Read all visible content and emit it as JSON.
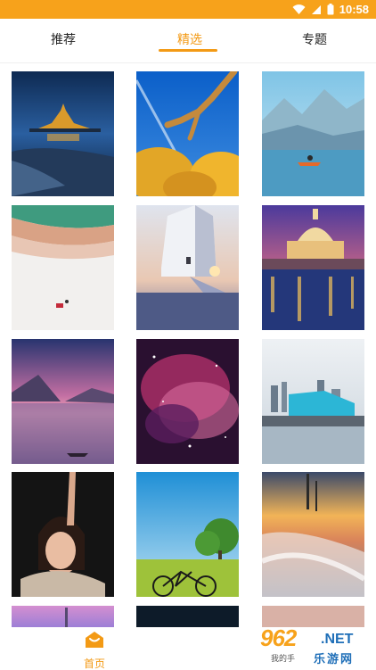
{
  "status_bar": {
    "time": "10:58",
    "color": "#f7a21b"
  },
  "tabs": [
    {
      "label": "推荐",
      "active": false
    },
    {
      "label": "精选",
      "active": true
    },
    {
      "label": "专题",
      "active": false
    }
  ],
  "accent_color": "#f39a15",
  "thumbnails": [
    {
      "subject": "night-castle-island"
    },
    {
      "subject": "bare-branch-blue-sky-autumn-trees"
    },
    {
      "subject": "kayaker-on-mountain-lake"
    },
    {
      "subject": "aerial-beach-waves"
    },
    {
      "subject": "white-tower-sunset"
    },
    {
      "subject": "domed-city-night-reflection"
    },
    {
      "subject": "pink-sky-mountain-lake-boat"
    },
    {
      "subject": "orion-nebula"
    },
    {
      "subject": "city-skyline-waterfront"
    },
    {
      "subject": "portrait-woman-raised-arm"
    },
    {
      "subject": "bicycle-on-green-meadow"
    },
    {
      "subject": "sunset-long-exposure-waves"
    },
    {
      "subject": "partial-pink-spire"
    },
    {
      "subject": "partial-dark-night"
    },
    {
      "subject": "partial-pale-sky"
    }
  ],
  "bottom_nav": {
    "home_label": "首页"
  },
  "watermark": {
    "brand": "962",
    "suffix": ".NET",
    "cn": "乐游网",
    "sub": "我的手"
  }
}
